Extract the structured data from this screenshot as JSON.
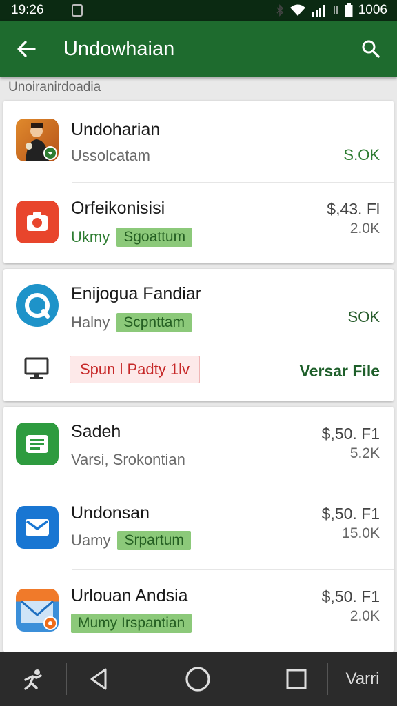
{
  "status_bar": {
    "time": "19:26",
    "battery_level": "1006"
  },
  "app_bar": {
    "title": "Undowhaian"
  },
  "section_header": "Unoiranirdoadia",
  "items": [
    {
      "name": "Undoharian",
      "subtitle": "Ussolcatam",
      "price": "S.OK",
      "icon": "portrait-app-icon"
    },
    {
      "name": "Orfeikonisisi",
      "subtitle": "Ukmy",
      "tag": "Sgoattum",
      "price": "$,43. Fl",
      "size": "2.0K",
      "icon": "camera-app-icon"
    },
    {
      "name": "Enijogua Fandiar",
      "subtitle": "Halny",
      "tag": "Scpnttam",
      "price": "SOK",
      "icon": "circle-app-icon",
      "sale_badge": "Spun l Padty 1lv",
      "action": "Versar File"
    },
    {
      "name": "Sadeh",
      "subtitle": "Varsi, Srokontian",
      "price": "$,50. F1",
      "size": "5.2K",
      "icon": "sheets-app-icon"
    },
    {
      "name": "Undonsan",
      "subtitle": "Uamy",
      "tag": "Srpartum",
      "price": "$,50. F1",
      "size": "15.0K",
      "icon": "mail-app-icon"
    },
    {
      "name": "Urlouan Andsia",
      "tag": "Mumy Irspantian",
      "price": "$,50. F1",
      "size": "2.0K",
      "icon": "envelope-app-icon"
    }
  ],
  "nav_bar": {
    "right_label": "Varri"
  },
  "colors": {
    "app_bar": "#1e6b2e",
    "status_bar": "#0b2a12",
    "accent_green": "#2e7d32",
    "tag_bg": "#8cc97a",
    "sale_red": "#c62828"
  }
}
